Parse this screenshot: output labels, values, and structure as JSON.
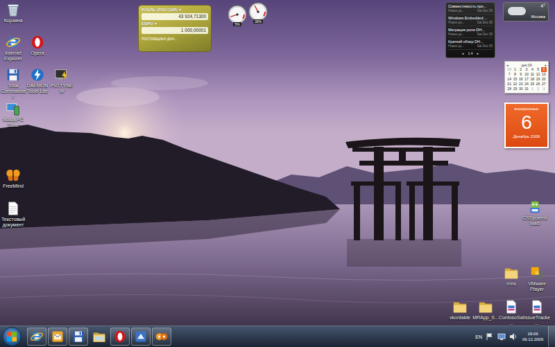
{
  "desktop": {
    "icons": [
      {
        "label": "Корзина",
        "kind": "recycle"
      },
      {
        "label": "Internet Explorer",
        "kind": "ie"
      },
      {
        "label": "Opera",
        "kind": "opera"
      },
      {
        "label": "Total Commander",
        "kind": "floppy"
      },
      {
        "label": "DAEMON Tools Lite",
        "kind": "bolt"
      },
      {
        "label": "PuTTYNEW",
        "kind": "putty"
      },
      {
        "label": "Nokia PC Suite",
        "kind": "nokia"
      },
      {
        "label": "FreeMind",
        "kind": "butterfly"
      },
      {
        "label": "Текстовый документ",
        "kind": "textdoc"
      },
      {
        "label": "CSSpoems Web",
        "kind": "robot"
      },
      {
        "label": "rrms",
        "kind": "folder"
      },
      {
        "label": "VMware Player",
        "kind": "vmware"
      },
      {
        "label": "vkontakte",
        "kind": "folder"
      },
      {
        "label": "MRApp_S...",
        "kind": "folder"
      },
      {
        "label": "ContosoSal...",
        "kind": "document"
      },
      {
        "label": "IssueTracke...",
        "kind": "document"
      }
    ]
  },
  "gadgets": {
    "currency": {
      "rows": [
        {
          "currency": "РУБЛЬ (РОССИЯ)",
          "arrow": "▾",
          "value": "43 924,71300"
        },
        {
          "currency": "ЕВРО",
          "arrow": "▾",
          "value": "1 000,00001"
        }
      ],
      "footer": "ПОСТАВЩИКИ ДАН..."
    },
    "cpu_meter": {
      "dials": [
        {
          "reading": "5%",
          "level": 0.05
        },
        {
          "reading": "38%",
          "level": 0.38
        }
      ]
    },
    "feed": {
      "items": [
        {
          "title": "Совместимость при...",
          "source": "Новое до...",
          "date": "Sat Dec 05"
        },
        {
          "title": "Windows Embedded ...",
          "source": "Новое до...",
          "date": "Sat Dec 05"
        },
        {
          "title": "Миграция роли DH...",
          "source": "Новое до...",
          "date": "Sat Dec 05"
        },
        {
          "title": "Краткий обзор DH...",
          "source": "Новое до...",
          "date": "Sat Dec 05"
        }
      ],
      "prev": "◂",
      "page": "1-4",
      "next": "▸"
    },
    "weather": {
      "temperature": "4°",
      "city": "Москва"
    },
    "calendar": {
      "month": "дек 09",
      "prev": "◂",
      "next": "▸",
      "weeks": [
        [
          {
            "day": "30",
            "in_month": false,
            "selected": false
          },
          {
            "day": "1",
            "in_month": true,
            "selected": false
          },
          {
            "day": "2",
            "in_month": true,
            "selected": false
          },
          {
            "day": "3",
            "in_month": true,
            "selected": false
          },
          {
            "day": "4",
            "in_month": true,
            "selected": false
          },
          {
            "day": "5",
            "in_month": true,
            "selected": false
          },
          {
            "day": "6",
            "in_month": true,
            "selected": true
          }
        ],
        [
          {
            "day": "7",
            "in_month": true,
            "selected": false
          },
          {
            "day": "8",
            "in_month": true,
            "selected": false
          },
          {
            "day": "9",
            "in_month": true,
            "selected": false
          },
          {
            "day": "10",
            "in_month": true,
            "selected": false
          },
          {
            "day": "11",
            "in_month": true,
            "selected": false
          },
          {
            "day": "12",
            "in_month": true,
            "selected": false
          },
          {
            "day": "13",
            "in_month": true,
            "selected": false
          }
        ],
        [
          {
            "day": "14",
            "in_month": true,
            "selected": false
          },
          {
            "day": "15",
            "in_month": true,
            "selected": false
          },
          {
            "day": "16",
            "in_month": true,
            "selected": false
          },
          {
            "day": "17",
            "in_month": true,
            "selected": false
          },
          {
            "day": "18",
            "in_month": true,
            "selected": false
          },
          {
            "day": "19",
            "in_month": true,
            "selected": false
          },
          {
            "day": "20",
            "in_month": true,
            "selected": false
          }
        ],
        [
          {
            "day": "21",
            "in_month": true,
            "selected": false
          },
          {
            "day": "22",
            "in_month": true,
            "selected": false
          },
          {
            "day": "23",
            "in_month": true,
            "selected": false
          },
          {
            "day": "24",
            "in_month": true,
            "selected": false
          },
          {
            "day": "25",
            "in_month": true,
            "selected": false
          },
          {
            "day": "26",
            "in_month": true,
            "selected": false
          },
          {
            "day": "27",
            "in_month": true,
            "selected": false
          }
        ],
        [
          {
            "day": "28",
            "in_month": true,
            "selected": false
          },
          {
            "day": "29",
            "in_month": true,
            "selected": false
          },
          {
            "day": "30",
            "in_month": true,
            "selected": false
          },
          {
            "day": "31",
            "in_month": true,
            "selected": false
          },
          {
            "day": "1",
            "in_month": false,
            "selected": false
          },
          {
            "day": "2",
            "in_month": false,
            "selected": false
          },
          {
            "day": "3",
            "in_month": false,
            "selected": false
          }
        ]
      ]
    },
    "date": {
      "weekday": "воскресенье",
      "day": "6",
      "month": "Декабрь 2009"
    }
  },
  "taskbar": {
    "buttons": [
      {
        "kind": "ie",
        "running": true
      },
      {
        "kind": "outlook",
        "running": true
      },
      {
        "kind": "floppy",
        "running": true
      },
      {
        "kind": "explorer",
        "running": false
      },
      {
        "kind": "opera",
        "running": true
      },
      {
        "kind": "app",
        "running": true
      },
      {
        "kind": "messenger",
        "running": true
      }
    ],
    "tray": {
      "language": "EN",
      "time": "19:09",
      "date": "06.12.2009"
    }
  }
}
